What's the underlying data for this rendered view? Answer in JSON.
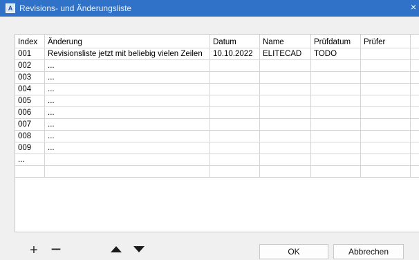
{
  "window": {
    "title": "Revisions- und Änderungsliste",
    "icon_letter": "A",
    "close_glyph": "×",
    "accent": "#2f72c8"
  },
  "table": {
    "columns": [
      "Index",
      "Änderung",
      "Datum",
      "Name",
      "Prüfdatum",
      "Prüfer",
      ""
    ],
    "rows": [
      [
        "001",
        "Revisionsliste jetzt mit beliebig vielen Zeilen",
        "10.10.2022",
        "ELITECAD",
        "TODO",
        "",
        ""
      ],
      [
        "002",
        "...",
        "",
        "",
        "",
        "",
        ""
      ],
      [
        "003",
        "...",
        "",
        "",
        "",
        "",
        ""
      ],
      [
        "004",
        "...",
        "",
        "",
        "",
        "",
        ""
      ],
      [
        "005",
        "...",
        "",
        "",
        "",
        "",
        ""
      ],
      [
        "006",
        "...",
        "",
        "",
        "",
        "",
        ""
      ],
      [
        "007",
        "...",
        "",
        "",
        "",
        "",
        ""
      ],
      [
        "008",
        "...",
        "",
        "",
        "",
        "",
        ""
      ],
      [
        "009",
        "...",
        "",
        "",
        "",
        "",
        ""
      ],
      [
        "...",
        "",
        "",
        "",
        "",
        "",
        ""
      ],
      [
        "",
        "",
        "",
        "",
        "",
        "",
        ""
      ]
    ]
  },
  "toolbar": {
    "add_label": "+",
    "remove_label": "−",
    "move_up_icon": "triangle-up",
    "move_down_icon": "triangle-down"
  },
  "dialog_buttons": {
    "ok_label": "OK",
    "cancel_label": "Abbrechen"
  }
}
